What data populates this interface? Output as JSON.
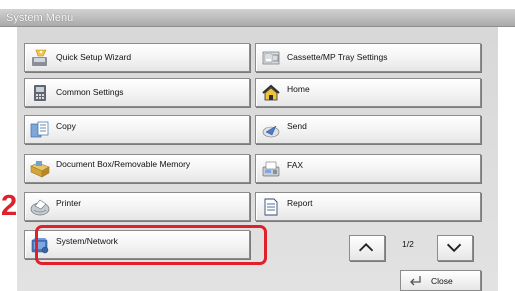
{
  "window": {
    "title": "System Menu"
  },
  "menu": {
    "left": [
      {
        "label": "Quick Setup Wizard",
        "icon": "wizard-icon"
      },
      {
        "label": "Common Settings",
        "icon": "settings-icon"
      },
      {
        "label": "Copy",
        "icon": "copy-icon"
      },
      {
        "label": "Document Box/Removable Memory",
        "icon": "document-box-icon"
      },
      {
        "label": "Printer",
        "icon": "printer-icon"
      },
      {
        "label": "System/Network",
        "icon": "network-icon"
      }
    ],
    "right": [
      {
        "label": "Cassette/MP Tray Settings",
        "icon": "tray-icon"
      },
      {
        "label": "Home",
        "icon": "home-icon"
      },
      {
        "label": "Send",
        "icon": "send-icon"
      },
      {
        "label": "FAX",
        "icon": "fax-icon"
      },
      {
        "label": "Report",
        "icon": "report-icon"
      }
    ]
  },
  "annotation": {
    "step_number": "2",
    "highlight_color": "#e0202a"
  },
  "pagination": {
    "indicator": "1/2"
  },
  "close_button": {
    "label": "Close"
  }
}
